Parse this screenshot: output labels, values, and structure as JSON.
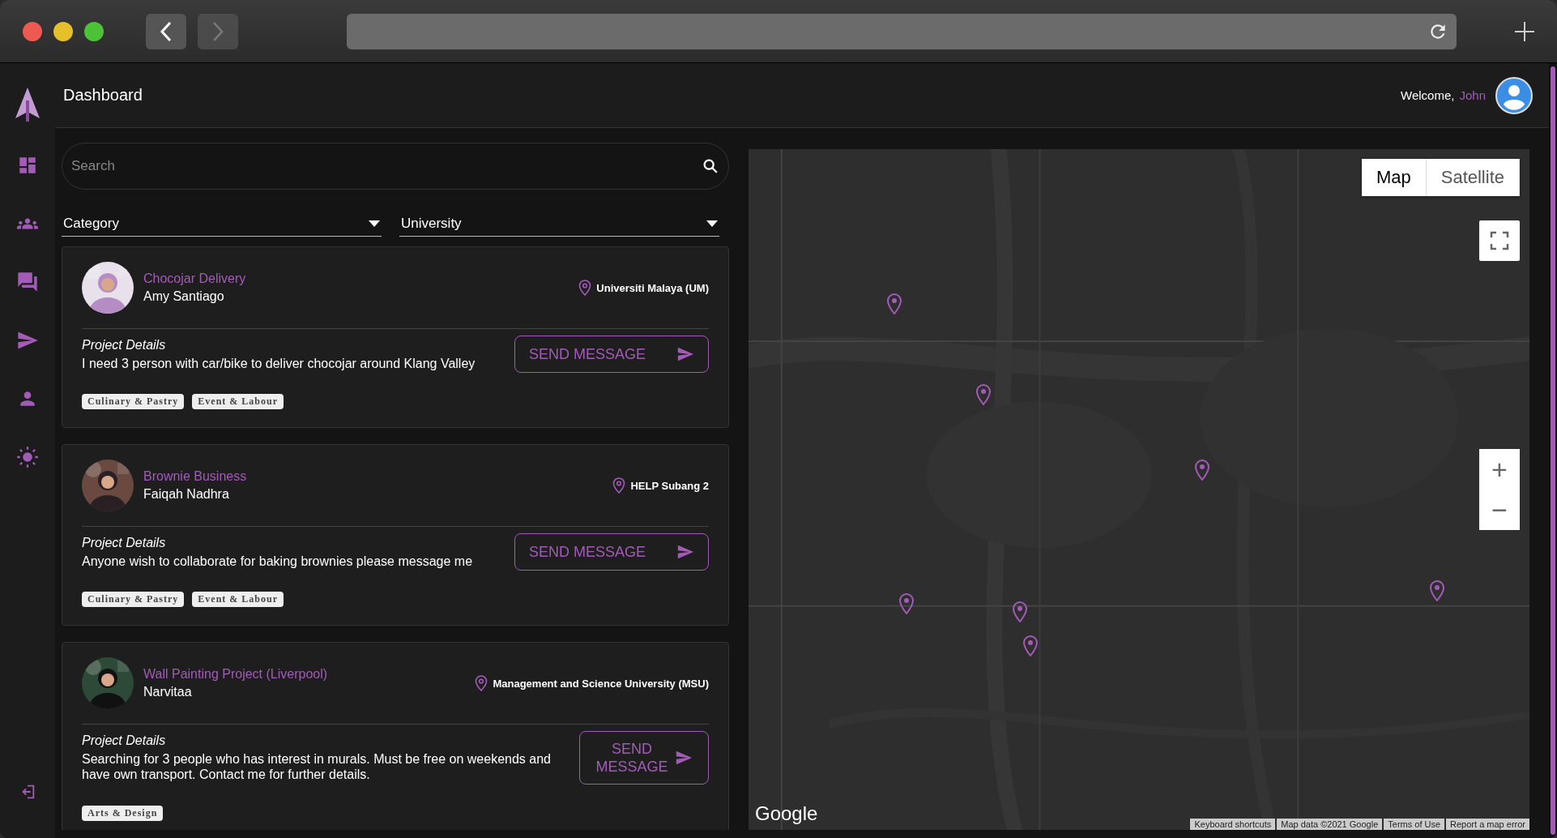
{
  "header": {
    "title": "Dashboard",
    "welcome": "Welcome,",
    "user": "John"
  },
  "sidebar": {
    "items": [
      {
        "kind": "dashboard",
        "selected": false
      },
      {
        "kind": "group",
        "selected": false
      },
      {
        "kind": "chat",
        "selected": false
      },
      {
        "kind": "send",
        "selected": false
      },
      {
        "kind": "person",
        "selected": false
      },
      {
        "kind": "theme",
        "selected": false
      }
    ]
  },
  "search": {
    "placeholder": "Search"
  },
  "filters": [
    {
      "label": "Category"
    },
    {
      "label": "University"
    }
  ],
  "projects": [
    {
      "title": "Chocojar Delivery",
      "owner": "Amy Santiago",
      "location": "Universiti Malaya (UM)",
      "details_label": "Project Details",
      "details": "I need 3 person with car/bike to deliver chocojar around Klang Valley",
      "button": "SEND MESSAGE",
      "tags": [
        "Culinary & Pastry",
        "Event & Labour"
      ]
    },
    {
      "title": "Brownie Business",
      "owner": "Faiqah Nadhra",
      "location": "HELP Subang 2",
      "details_label": "Project Details",
      "details": "Anyone wish to collaborate for baking brownies please message me",
      "button": "SEND MESSAGE",
      "tags": [
        "Culinary & Pastry",
        "Event & Labour"
      ]
    },
    {
      "title": "Wall Painting Project (Liverpool)",
      "owner": "Narvitaa",
      "location": "Management and Science University (MSU)",
      "details_label": "Project Details",
      "details": "Searching for 3 people who has interest in murals. Must be free on weekends and have own transport. Contact me for further details.",
      "button": "SEND MESSAGE",
      "tags": [
        "Arts & Design"
      ]
    }
  ],
  "map": {
    "types": [
      {
        "label": "Map",
        "selected": true
      },
      {
        "label": "Satellite",
        "selected": false
      }
    ],
    "zoom_in": "+",
    "zoom_out": "−",
    "logo": "Google",
    "footer": [
      "Keyboard shortcuts",
      "Map data ©2021 Google",
      "Terms of Use",
      "Report a map error"
    ]
  }
}
